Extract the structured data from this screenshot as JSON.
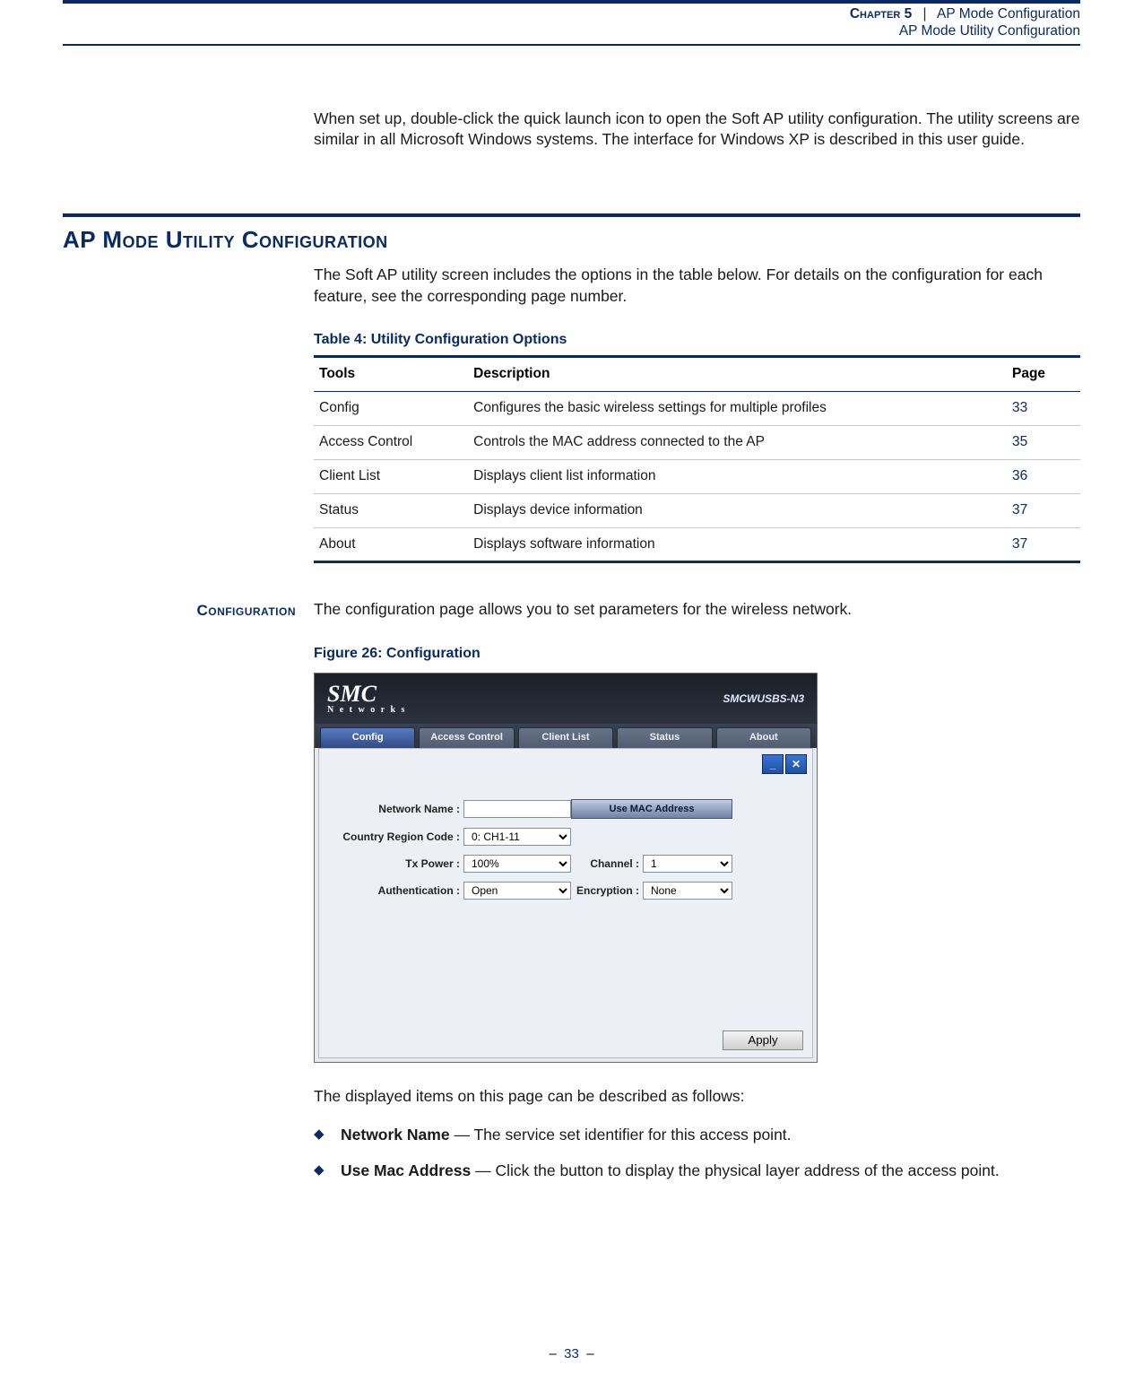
{
  "header": {
    "chapter_word": "Chapter",
    "chapter_number": "5",
    "separator": "|",
    "chapter_title": "AP Mode Configuration",
    "subsection": "AP Mode Utility Configuration"
  },
  "intro_paragraph": "When set up, double-click the quick launch icon to open the Soft AP utility configuration. The utility screens are similar in all Microsoft Windows systems. The interface for Windows XP is described in this user guide.",
  "section": {
    "title": "AP Mode Utility Configuration",
    "intro": "The Soft AP utility screen includes the options in the table below. For details on the configuration for each feature, see the corresponding page number."
  },
  "table": {
    "caption": "Table 4: Utility Configuration Options",
    "headers": {
      "tools": "Tools",
      "description": "Description",
      "page": "Page"
    },
    "rows": [
      {
        "tool": "Config",
        "desc": "Configures the basic wireless settings for multiple profiles",
        "page": "33"
      },
      {
        "tool": "Access Control",
        "desc": "Controls the MAC address connected to the AP",
        "page": "35"
      },
      {
        "tool": "Client List",
        "desc": "Displays client list information",
        "page": "36"
      },
      {
        "tool": "Status",
        "desc": "Displays device information",
        "page": "37"
      },
      {
        "tool": "About",
        "desc": "Displays software information",
        "page": "37"
      }
    ]
  },
  "configuration": {
    "gutter_label": "Configuration",
    "intro": "The configuration page allows you to set parameters for the wireless network.",
    "figure_caption": "Figure 26:  Configuration",
    "body_lead": "The displayed items on this page can be described as follows:",
    "bullets": [
      {
        "term": "Network Name",
        "text": " — The service set identifier for this access point."
      },
      {
        "term": "Use Mac Address",
        "text": " — Click the button to display the physical layer address of the access point."
      }
    ]
  },
  "figure": {
    "brand": "SMC",
    "brand_sub": "N e t w o r k s",
    "model": "SMCWUSBS-N3",
    "tabs": [
      "Config",
      "Access Control",
      "Client List",
      "Status",
      "About"
    ],
    "active_tab_index": 0,
    "minimize_glyph": "_",
    "close_glyph": "✕",
    "labels": {
      "network_name": "Network Name",
      "country_region": "Country Region Code",
      "tx_power": "Tx Power",
      "authentication": "Authentication",
      "channel": "Channel",
      "encryption": "Encryption"
    },
    "values": {
      "network_name": "",
      "country_region": "0: CH1-11",
      "tx_power": "100%",
      "authentication": "Open",
      "channel": "1",
      "encryption": "None"
    },
    "buttons": {
      "use_mac": "Use MAC Address",
      "apply": "Apply"
    }
  },
  "footer": {
    "dash": "–",
    "page_number": "33"
  }
}
